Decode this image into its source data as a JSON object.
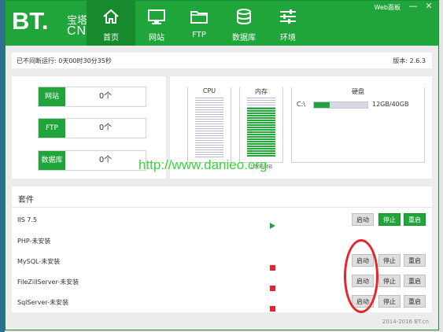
{
  "app": {
    "logo_main": "BT.",
    "logo_cn": "宝塔",
    "logo_suffix": "CN",
    "web_panel": "Web面板",
    "window_controls": [
      "—",
      "✕"
    ]
  },
  "nav": {
    "tabs": [
      {
        "label": "首页",
        "icon": "home-icon",
        "active": true
      },
      {
        "label": "网站",
        "icon": "monitor-icon",
        "active": false
      },
      {
        "label": "FTP",
        "icon": "folder-icon",
        "active": false
      },
      {
        "label": "数据库",
        "icon": "database-icon",
        "active": false
      },
      {
        "label": "环境",
        "icon": "sliders-icon",
        "active": false
      }
    ]
  },
  "infobar": {
    "uptime": "已不间断运行: 0天00时30分35秒",
    "version": "版本: 2.6.3"
  },
  "stats": [
    {
      "label": "网站",
      "value": "0个"
    },
    {
      "label": "FTP",
      "value": "0个"
    },
    {
      "label": "数据库",
      "value": "0个"
    }
  ],
  "meters": {
    "cpu": {
      "label": "CPU",
      "usage": 0.0,
      "value_text": ""
    },
    "memory": {
      "label": "内存",
      "usage": 0.83,
      "value_text": "1766MB"
    },
    "disk": {
      "label": "硬盘",
      "drive": "C:\\",
      "usage": 0.3,
      "value_text": "12GB/40GB"
    }
  },
  "plugins": {
    "title": "套件",
    "rows": [
      {
        "name": "IIS 7.5",
        "status": "running",
        "buttons": [
          "启动",
          "停止",
          "重启"
        ],
        "enabled": true
      },
      {
        "name": "PHP-未安装",
        "status": "none",
        "buttons": [],
        "enabled": false
      },
      {
        "name": "MySQL-未安装",
        "status": "stopped",
        "buttons": [
          "启动",
          "停止",
          "重启"
        ],
        "enabled": false
      },
      {
        "name": "FileZillServer-未安装",
        "status": "stopped",
        "buttons": [
          "启动",
          "停止",
          "重启"
        ],
        "enabled": false
      },
      {
        "name": "SqlServer-未安装",
        "status": "stopped",
        "buttons": [
          "启动",
          "停止",
          "重启"
        ],
        "enabled": false
      }
    ]
  },
  "footer": {
    "copyright": "2014-2016 BT.cn"
  },
  "watermark": {
    "text": "http://www.danieo.org"
  },
  "colors": {
    "brand": "#20a53a",
    "status_running": "#20a53a",
    "status_stopped": "#e8232b",
    "annotation": "#e8232b"
  }
}
